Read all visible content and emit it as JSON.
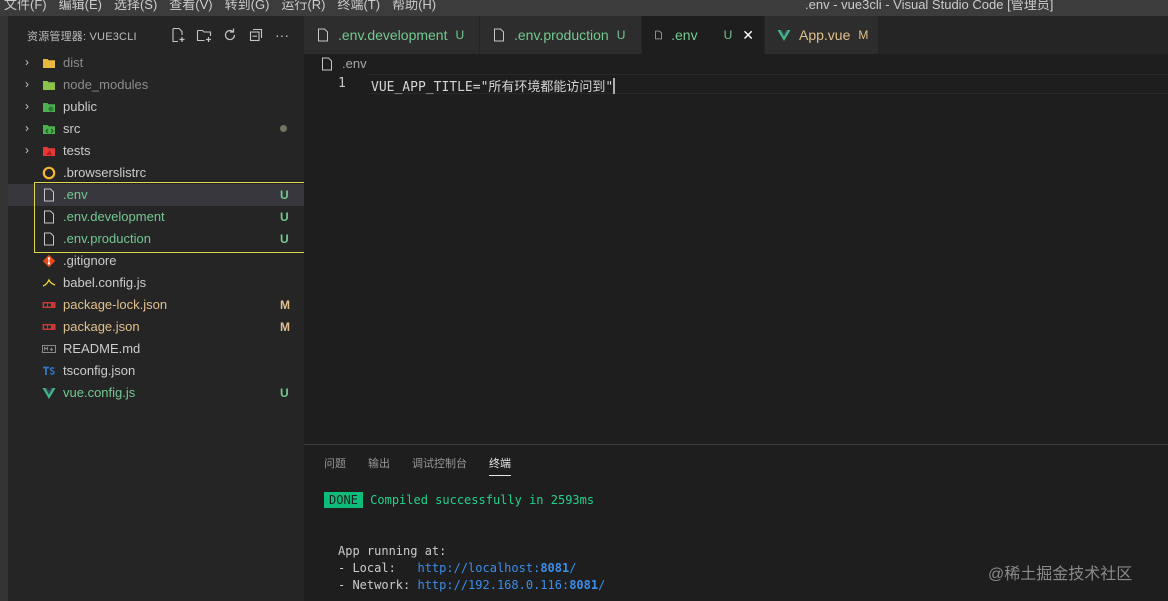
{
  "menu": {
    "items": [
      "文件(F)",
      "编辑(E)",
      "选择(S)",
      "查看(V)",
      "转到(G)",
      "运行(R)",
      "终端(T)",
      "帮助(H)"
    ],
    "window_title": ".env - vue3cli - Visual Studio Code [管理员]"
  },
  "sidebar": {
    "title": "资源管理器: VUE3CLI",
    "actions": [
      "new-file-icon",
      "new-folder-icon",
      "refresh-icon",
      "collapse-all-icon",
      "more-icon"
    ],
    "more_glyph": "···",
    "items": [
      {
        "name": "dist",
        "folder": true,
        "icon": "dist-folder-icon",
        "status": "",
        "color": "#8c8c8c"
      },
      {
        "name": "node_modules",
        "folder": true,
        "icon": "node-folder-icon",
        "status": "",
        "color": "#8c8c8c"
      },
      {
        "name": "public",
        "folder": true,
        "icon": "public-folder-icon",
        "status": "",
        "color": "#cccccc"
      },
      {
        "name": "src",
        "folder": true,
        "icon": "src-folder-icon",
        "status": "dot",
        "color": "#cccccc"
      },
      {
        "name": "tests",
        "folder": true,
        "icon": "tests-folder-icon",
        "status": "",
        "color": "#cccccc"
      },
      {
        "name": ".browserslistrc",
        "folder": false,
        "icon": "browserslist-icon",
        "status": "",
        "color": "#cccccc"
      },
      {
        "name": ".env",
        "folder": false,
        "icon": "file-icon",
        "status": "U",
        "color": "#73c991",
        "selected": true
      },
      {
        "name": ".env.development",
        "folder": false,
        "icon": "file-icon",
        "status": "U",
        "color": "#73c991"
      },
      {
        "name": ".env.production",
        "folder": false,
        "icon": "file-icon",
        "status": "U",
        "color": "#73c991"
      },
      {
        "name": ".gitignore",
        "folder": false,
        "icon": "git-icon",
        "status": "",
        "color": "#cccccc"
      },
      {
        "name": "babel.config.js",
        "folder": false,
        "icon": "babel-icon",
        "status": "",
        "color": "#cccccc"
      },
      {
        "name": "package-lock.json",
        "folder": false,
        "icon": "npm-icon",
        "status": "M",
        "color": "#e2c08d"
      },
      {
        "name": "package.json",
        "folder": false,
        "icon": "npm-icon",
        "status": "M",
        "color": "#e2c08d"
      },
      {
        "name": "README.md",
        "folder": false,
        "icon": "readme-icon",
        "status": "",
        "color": "#cccccc"
      },
      {
        "name": "tsconfig.json",
        "folder": false,
        "icon": "typescript-icon",
        "status": "",
        "color": "#cccccc"
      },
      {
        "name": "vue.config.js",
        "folder": false,
        "icon": "vue-icon",
        "status": "U",
        "color": "#73c991"
      }
    ]
  },
  "tabs": [
    {
      "label": ".env.development",
      "flag": "U",
      "icon": "file-icon",
      "active": false,
      "color": "#73c991"
    },
    {
      "label": ".env.production",
      "flag": "U",
      "icon": "file-icon",
      "active": false,
      "color": "#73c991"
    },
    {
      "label": ".env",
      "flag": "U",
      "icon": "file-icon",
      "active": true,
      "color": "#73c991",
      "close": "✕"
    },
    {
      "label": "App.vue",
      "flag": "M",
      "icon": "vue-icon",
      "active": false,
      "color": "#e2c08d"
    }
  ],
  "editor": {
    "breadcrumb": ".env",
    "line_number": "1",
    "code": "VUE_APP_TITLE=\"所有环境都能访问到\""
  },
  "panel": {
    "tabs": [
      "问题",
      "输出",
      "调试控制台",
      "终端"
    ],
    "active_tab": "终端",
    "terminal": {
      "done_badge": "DONE",
      "compiled": "Compiled successfully in 2593ms",
      "running": "App running at:",
      "local_label": "- Local:   ",
      "local_url_pre": "http://localhost:",
      "local_port": "8081",
      "local_url_post": "/",
      "network_label": "- Network: ",
      "network_url_pre": "http://192.168.0.116:",
      "network_port": "8081",
      "network_url_post": "/"
    }
  },
  "watermark": "@稀土掘金技术社区"
}
